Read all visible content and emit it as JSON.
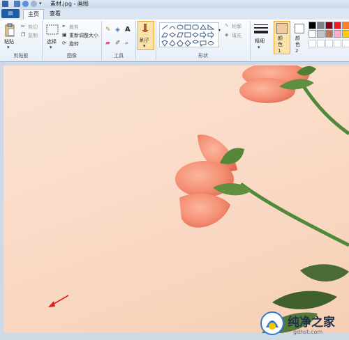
{
  "window": {
    "title": "素材.jpg - 画图"
  },
  "file_menu": {
    "label": "▤"
  },
  "tabs": [
    {
      "label": "主页"
    },
    {
      "label": "查看"
    }
  ],
  "ribbon": {
    "clipboard": {
      "paste": "粘贴",
      "cut": "剪切",
      "copy": "复制",
      "group_label": "剪贴板"
    },
    "image": {
      "select": "选择",
      "crop": "裁剪",
      "resize": "重新调整大小",
      "rotate": "旋转",
      "group_label": "图像"
    },
    "tools": {
      "group_label": "工具"
    },
    "brushes": {
      "label": "刷子"
    },
    "shapes": {
      "outline": "轮廓",
      "fill": "填充",
      "group_label": "形状"
    },
    "size": {
      "label": "粗细"
    },
    "color1": {
      "label": "颜色 1"
    },
    "color2": {
      "label": "颜色 2"
    },
    "palette": [
      "#000000",
      "#7f7f7f",
      "#880015",
      "#ed1c24",
      "#ff7f27",
      "#ffffff",
      "#c3c3c3",
      "#b97a57",
      "#ffaec9",
      "#ffc90e"
    ]
  },
  "watermark": {
    "text": "纯净之家",
    "url": "gdhst.com"
  },
  "colors": {
    "color1": "#f2c9a3",
    "color2": "#ffffff",
    "image_bg": "#f9dac6"
  }
}
